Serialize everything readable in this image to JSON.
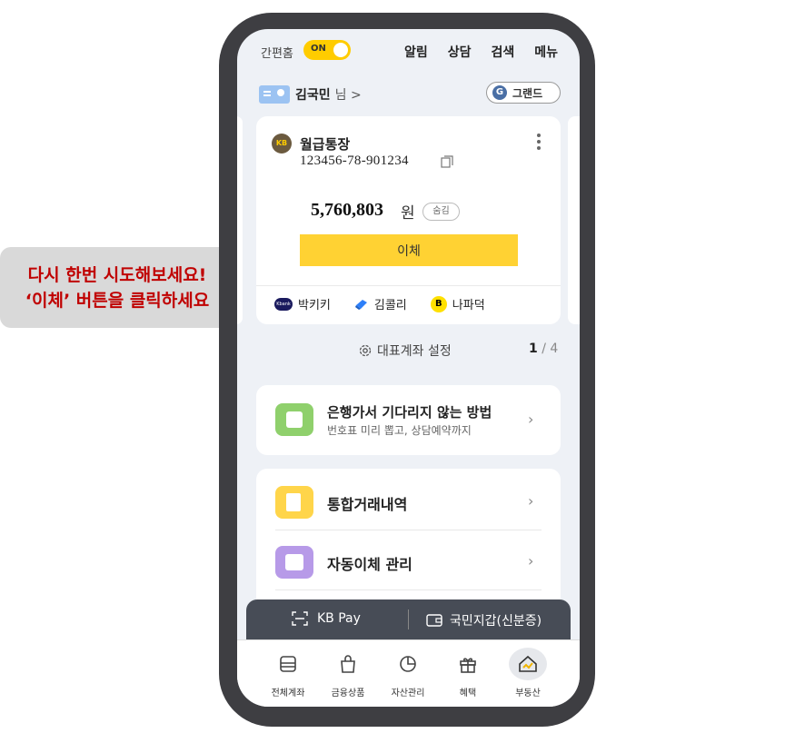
{
  "tooltip": {
    "line1": "다시 한번 시도해보세요!",
    "line2": "‘이체’ 버튼을 클릭하세요"
  },
  "topbar": {
    "simple_home_label": "간편홈",
    "toggle_label": "ON",
    "nav": [
      "알림",
      "상담",
      "검색",
      "메뉴"
    ]
  },
  "user": {
    "name": "김국민",
    "suffix": "님 >",
    "grand_label": "그랜드",
    "grand_icon_letter": "G"
  },
  "account": {
    "name": "월급통장",
    "number": "123456-78-901234",
    "balance": "5,760,803",
    "currency": "원",
    "hide_label": "숨김",
    "transfer_label": "이체",
    "logo_text": "KB",
    "quick": [
      {
        "label": "박키키",
        "icon": "kbank-icon",
        "icon_text": "Kbank"
      },
      {
        "label": "김콜리",
        "icon": "toss-icon",
        "icon_text": ""
      },
      {
        "label": "나파덕",
        "icon": "kakaobank-icon",
        "icon_text": "B"
      }
    ]
  },
  "settings": {
    "label": "대표계좌 설정",
    "page_current": "1",
    "page_total": "/ 4"
  },
  "bank_banner": {
    "title": "은행가서 기다리지 않는 방법",
    "subtitle": "번호표 미리 뽑고, 상담예약까지"
  },
  "menu": [
    {
      "label": "통합거래내역",
      "icon": "receipt-icon"
    },
    {
      "label": "자동이체 관리",
      "icon": "calendar-check-icon"
    }
  ],
  "paybar": {
    "kbpay_label": "KB Pay",
    "wallet_label": "국민지갑(신분증)"
  },
  "bottomnav": [
    {
      "label": "전체계좌",
      "icon": "account-list-icon"
    },
    {
      "label": "금융상품",
      "icon": "shopping-bag-icon"
    },
    {
      "label": "자산관리",
      "icon": "pie-chart-icon"
    },
    {
      "label": "혜택",
      "icon": "gift-icon"
    },
    {
      "label": "부동산",
      "icon": "house-icon"
    }
  ],
  "colors": {
    "accent": "#ffd233",
    "tooltip_text": "#c00000",
    "phone_frame": "#3e3e42",
    "screen_bg": "#eef1f6"
  }
}
